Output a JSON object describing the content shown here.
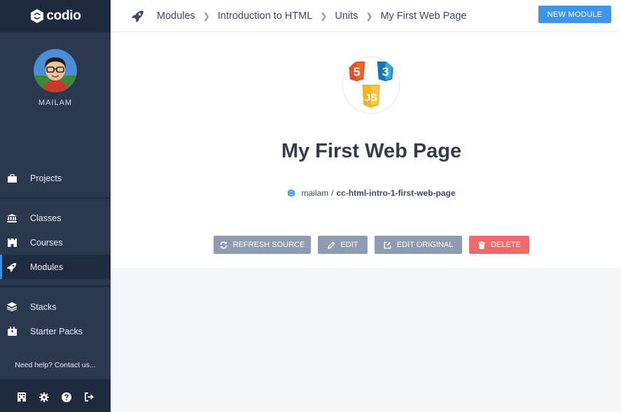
{
  "app": {
    "logo_text": "codio"
  },
  "user": {
    "name": "MAILAM"
  },
  "sidebar": {
    "items": [
      {
        "label": "Projects",
        "icon": "briefcase-icon"
      },
      {
        "label": "Classes",
        "icon": "institution-icon"
      },
      {
        "label": "Courses",
        "icon": "castle-icon"
      },
      {
        "label": "Modules",
        "icon": "rocket-icon",
        "active": true
      },
      {
        "label": "Stacks",
        "icon": "layers-icon"
      },
      {
        "label": "Starter Packs",
        "icon": "package-icon"
      }
    ],
    "help_text": "Need help? Contact us...",
    "bottom_icons": [
      "building-icon",
      "gear-icon",
      "question-icon",
      "logout-icon"
    ]
  },
  "header": {
    "breadcrumbs": [
      "Modules",
      "Introduction to HTML",
      "Units",
      "My First Web Page"
    ],
    "new_module_label": "NEW MODULE"
  },
  "module": {
    "title": "My First Web Page",
    "owner": "mailam",
    "separator": "/",
    "slug": "cc-html-intro-1-first-web-page",
    "logo_labels": [
      "5",
      "3",
      "JS"
    ]
  },
  "actions": {
    "refresh_label": "REFRESH SOURCE",
    "edit_label": "EDIT",
    "edit_original_label": "EDIT ORIGINAL",
    "delete_label": "DELETE"
  },
  "colors": {
    "sidebar_bg": "#2a3950",
    "sidebar_dark": "#1e2b3e",
    "accent": "#3f95e8",
    "button_gray": "#8e9bb0",
    "button_red": "#ef6b6b"
  }
}
